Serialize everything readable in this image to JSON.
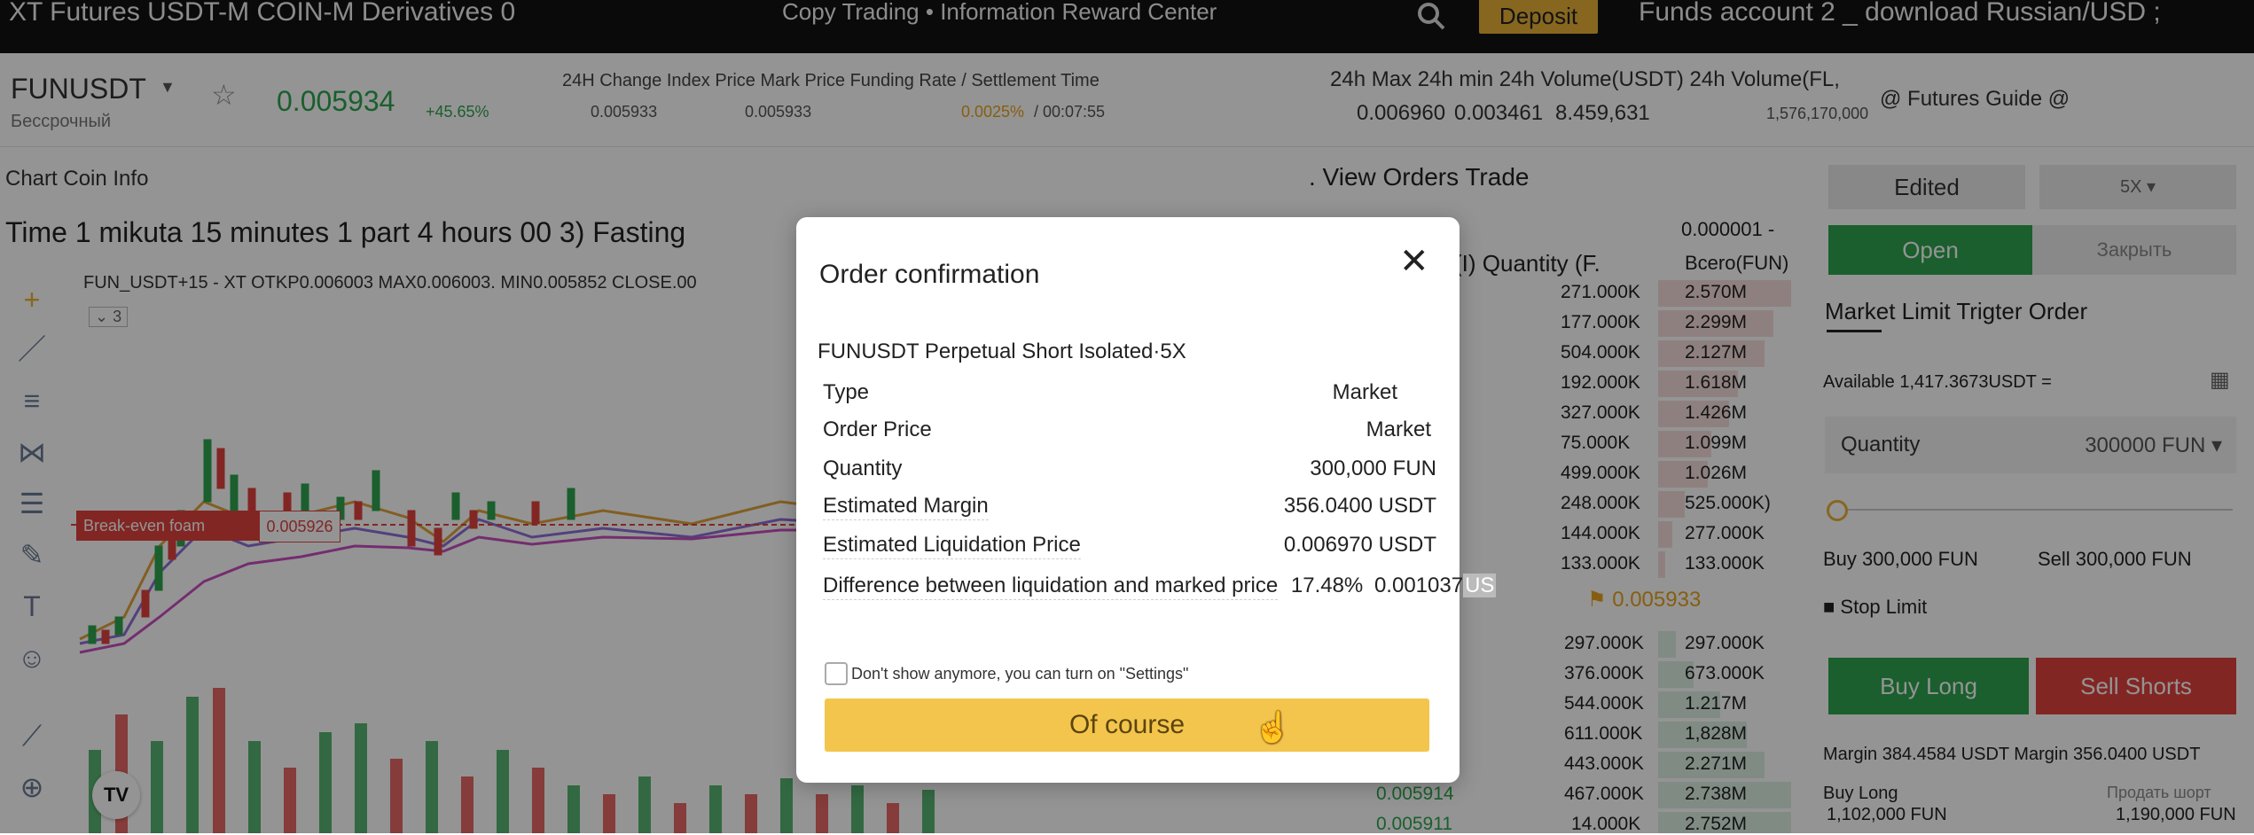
{
  "topnav": {
    "left_text": "XT  Futures  USDT-M  COIN-M  Derivatives  0",
    "center_text": "Copy Trading • Information Reward Center",
    "deposit_label": "Deposit",
    "right_text": "Funds account 2 _ download Russian/USD ;"
  },
  "ticker": {
    "symbol": "FUNUSDT",
    "symbol_sub": "Бессрочный",
    "last_price": "0.005934",
    "change_pct": "+45.65%",
    "headers_left": "24H Change  Index Price  Mark Price  Funding Rate / Settlement Time",
    "index_price": "0.005933",
    "mark_price": "0.005933",
    "funding_rate": "0.0025%",
    "settlement_time": "/ 00:07:55",
    "headers_right": "24h Max  24h min  24h Volume(USDT)  24h Volume(FL,",
    "max_24h": "0.006960",
    "min_24h": "0.003461",
    "volume_usdt": "8.459,631",
    "volume_fun": "1,576,170,000",
    "guide": "@ Futures Guide @"
  },
  "chart": {
    "tabs": "Chart  Coin  Info",
    "timeframes": "Time  1 mikuta  15 minutes  1 part  4 hours  00  3)  Fasting",
    "ohlc": "FUN_USDT+15 - XT  OTKP0.006003  MAX0.006003.  MIN0.005852  CLOSE.00",
    "indicator_count": "3",
    "break_even_label": "Break-even foam",
    "break_even_price": "0.005926",
    "logo_text": "TV"
  },
  "orderbook": {
    "header_tabs": ". View  Orders  Trade",
    "precision": "0.000001  -",
    "col_qty": "(I)  Quantity  (F.",
    "col_total": "Bcero(FUN)",
    "asks": [
      {
        "qty": "271.000K",
        "total": "2.570M"
      },
      {
        "qty": "177.000K",
        "total": "2.299M"
      },
      {
        "qty": "504.000K",
        "total": "2.127M"
      },
      {
        "qty": "192.000K",
        "total": "1.618M"
      },
      {
        "qty": "327.000K",
        "total": "1.426M"
      },
      {
        "qty": "75.000K",
        "total": "1.099M"
      },
      {
        "qty": "499.000K",
        "total": "1.026M"
      },
      {
        "qty": "248.000K",
        "total": "525.000K)"
      },
      {
        "qty": "144.000K",
        "total": "277.000K"
      },
      {
        "qty": "133.000K",
        "total": "133.000K"
      }
    ],
    "mid_price": "0.005933",
    "bids": [
      {
        "price": "",
        "qty": "297.000K",
        "total": "297.000K"
      },
      {
        "price": "",
        "qty": "376.000K",
        "total": "673.000K"
      },
      {
        "price": "",
        "qty": "544.000K",
        "total": "1.217M"
      },
      {
        "price": "",
        "qty": "611.000K",
        "total": "1,828M"
      },
      {
        "price": "",
        "qty": "443.000K",
        "total": "2.271M"
      },
      {
        "price": "0.005914",
        "qty": "467.000K",
        "total": "2.738M"
      },
      {
        "price": "0.005911",
        "qty": "14.000K",
        "total": "2.752M"
      }
    ]
  },
  "trade_panel": {
    "margin_mode": "Edited",
    "leverage": "5X",
    "open_tab": "Open",
    "close_tab": "Закрыть",
    "order_types": "Market  Limit  Trigter  Order",
    "available": "Available  1,417.3673USDT  =",
    "quantity_label": "Quantity",
    "quantity_value": "300000 FUN",
    "buy_info": "Buy 300,000 FUN",
    "sell_info": "Sell 300,000 FUN",
    "stop_limit": "Stop Limit",
    "buy_long": "Buy Long",
    "sell_shorts": "Sell Shorts",
    "margin_line": "Margin  384.4584 USDT  Margin  356.0400 USDT",
    "buy_long_label": "Buy Long",
    "buy_long_amount": "1,102,000 FUN",
    "sell_short_label": "Продать шорт",
    "sell_short_amount": "1,190,000 FUN"
  },
  "modal": {
    "title": "Order confirmation",
    "subtitle": "FUNUSDT  Perpetual  Short  Isolated·5X",
    "rows": [
      {
        "label": "Type",
        "value": "Market"
      },
      {
        "label": "Order Price",
        "value": "Market"
      },
      {
        "label": "Quantity",
        "value": "300,000  FUN"
      },
      {
        "label": "Estimated Margin",
        "value": "356.0400  USDT"
      },
      {
        "label": "Estimated Liquidation Price",
        "value": "0.006970  USDT"
      }
    ],
    "difference_label": "Difference between liquidation and marked price",
    "difference_pct": "17.48%",
    "difference_value": "0.001037",
    "difference_unit": "US",
    "dont_show": "Don't show anymore, you can turn on \"Settings\"",
    "confirm": "Of course"
  },
  "colors": {
    "accent_yellow": "#f4c54c",
    "green": "#2ea44f",
    "red": "#e0433f",
    "nav_bg": "#121212"
  }
}
